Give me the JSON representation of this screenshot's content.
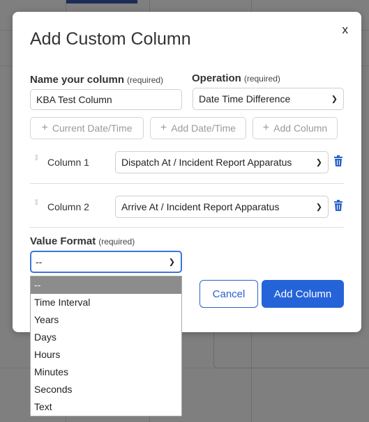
{
  "dialog": {
    "title": "Add Custom Column",
    "close_label": "x",
    "name_label": "Name your column",
    "operation_label": "Operation",
    "required_hint": "(required)",
    "name_value": "KBA Test Column",
    "operation_value": "Date Time Difference",
    "quick_buttons": [
      {
        "label": "Current Date/Time"
      },
      {
        "label": "Add Date/Time"
      },
      {
        "label": "Add Column"
      }
    ],
    "columns": [
      {
        "label": "Column 1",
        "value": "Dispatch At / Incident Report Apparatus"
      },
      {
        "label": "Column 2",
        "value": "Arrive At / Incident Report Apparatus"
      }
    ],
    "value_format_label": "Value Format",
    "value_format_value": "--",
    "value_format_options": [
      "--",
      "Time Interval",
      "Years",
      "Days",
      "Hours",
      "Minutes",
      "Seconds",
      "Text"
    ],
    "cancel_label": "Cancel",
    "submit_label": "Add Column"
  },
  "colors": {
    "primary": "#2563d9",
    "focus_border": "#3c75d9",
    "selected_option": "#8c8c8c",
    "trash": "#2a62c9"
  }
}
